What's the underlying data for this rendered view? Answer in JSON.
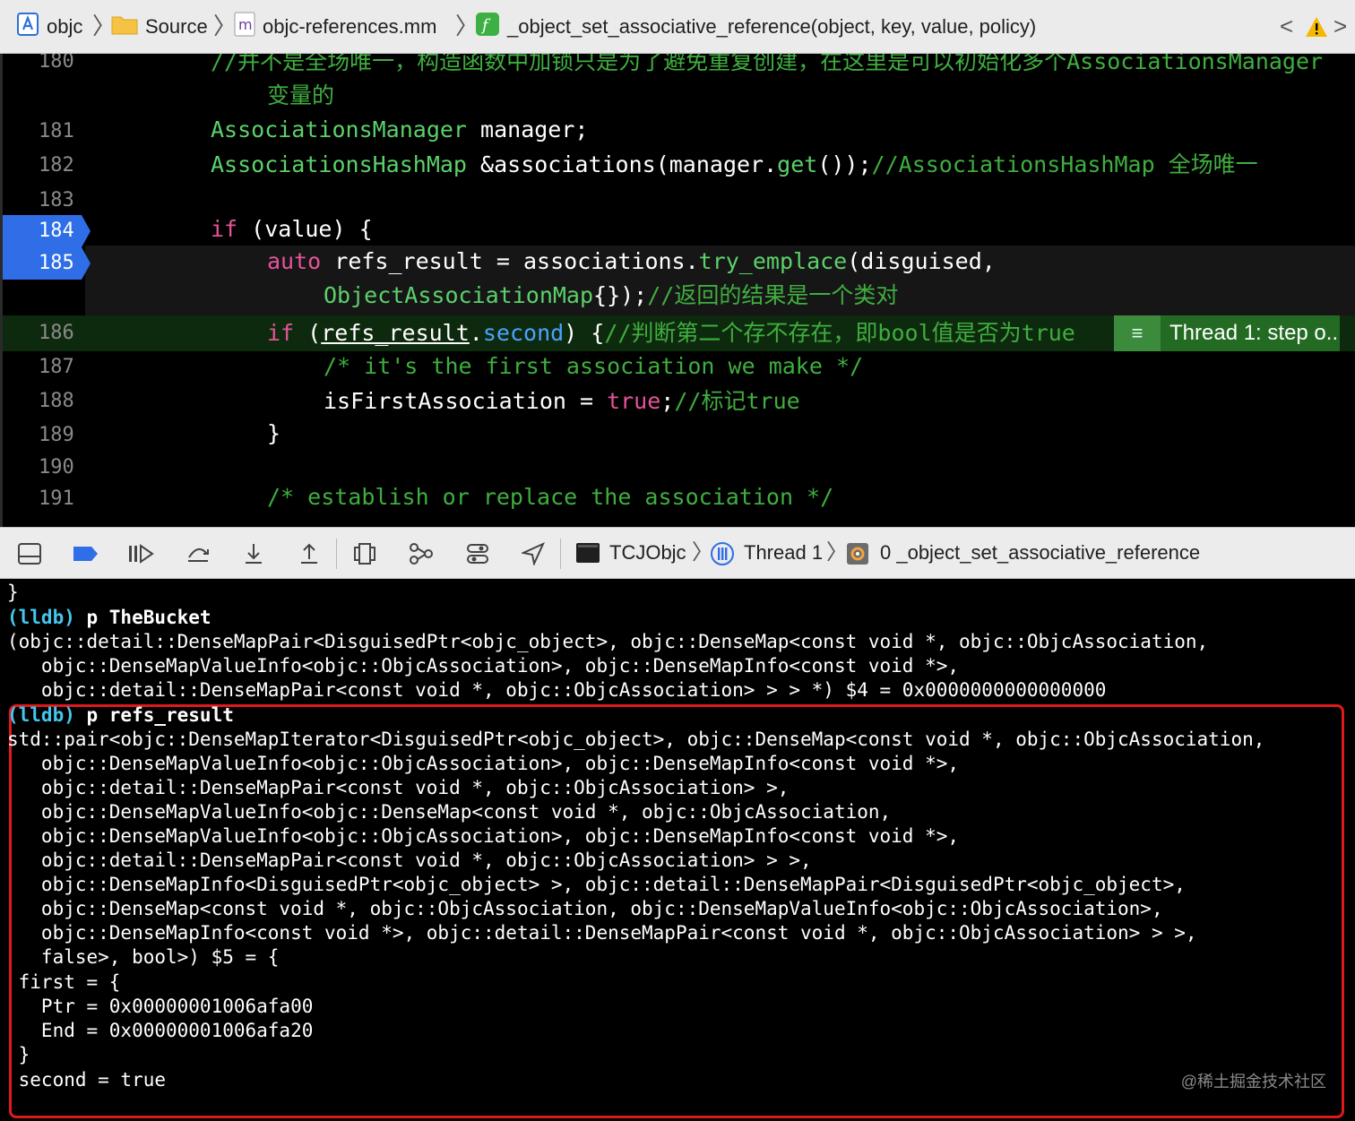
{
  "breadcrumb": {
    "project": "objc",
    "folder": "Source",
    "file": "objc-references.mm",
    "function": "_object_set_associative_reference(object, key, value, policy)"
  },
  "editor": {
    "lines": {
      "l180": "180",
      "l181": "181",
      "l182": "182",
      "l183": "183",
      "l184": "184",
      "l185": "185",
      "l186": "186",
      "l187": "187",
      "l188": "188",
      "l189": "189",
      "l190": "190",
      "l191": "191"
    },
    "code": {
      "c180a": "//并不是全场唯一，构造函数中加锁只是为了避免重复创建，在这里是可以初始化多个AssociationsManager",
      "c180b": "变量的",
      "c181_type": "AssociationsManager",
      "c181_rest": " manager;",
      "c182_type": "AssociationsHashMap",
      "c182_mid": " &associations(manager.",
      "c182_fn": "get",
      "c182_end": "());",
      "c182_cm": "//AssociationsHashMap 全场唯一",
      "c184_kw": "if",
      "c184_rest": " (value) {",
      "c185_kw": "auto",
      "c185_mid": " refs_result = associations.",
      "c185_fn": "try_emplace",
      "c185_end": "(disguised,",
      "c185b_type": "ObjectAssociationMap",
      "c185b_rest": "{});",
      "c185b_cm": "//返回的结果是一个类对",
      "c186_kw": "if",
      "c186_a": " (",
      "c186_var": "refs_result",
      "c186_dot": ".",
      "c186_prop": "second",
      "c186_b": ") {",
      "c186_cm": "//判断第二个存不存在，即bool值是否为true",
      "c187_cm": "/* it's the first association we make */",
      "c188_a": "isFirstAssociation = ",
      "c188_kw": "true",
      "c188_b": ";",
      "c188_cm": "//标记true",
      "c189": "}",
      "c191_cm": "/* establish or replace the association */"
    },
    "thread_badge": "Thread 1: step o..."
  },
  "debug_bar": {
    "target": "TCJObjc",
    "thread": "Thread 1",
    "frame": "0 _object_set_associative_reference"
  },
  "console": {
    "brace_top": "}",
    "prompt": "(lldb)",
    "cmd1": " p TheBucket",
    "out1_1": "(objc::detail::DenseMapPair<DisguisedPtr<objc_object>, objc::DenseMap<const void *, objc::ObjcAssociation,",
    "out1_2": "   objc::DenseMapValueInfo<objc::ObjcAssociation>, objc::DenseMapInfo<const void *>,",
    "out1_3": "   objc::detail::DenseMapPair<const void *, objc::ObjcAssociation> > > *) $4 = 0x0000000000000000",
    "cmd2": " p refs_result",
    "out2_1": "std::pair<objc::DenseMapIterator<DisguisedPtr<objc_object>, objc::DenseMap<const void *, objc::ObjcAssociation,",
    "out2_2": "   objc::DenseMapValueInfo<objc::ObjcAssociation>, objc::DenseMapInfo<const void *>,",
    "out2_3": "   objc::detail::DenseMapPair<const void *, objc::ObjcAssociation> >,",
    "out2_4": "   objc::DenseMapValueInfo<objc::DenseMap<const void *, objc::ObjcAssociation,",
    "out2_5": "   objc::DenseMapValueInfo<objc::ObjcAssociation>, objc::DenseMapInfo<const void *>,",
    "out2_6": "   objc::detail::DenseMapPair<const void *, objc::ObjcAssociation> > >,",
    "out2_7": "   objc::DenseMapInfo<DisguisedPtr<objc_object> >, objc::detail::DenseMapPair<DisguisedPtr<objc_object>,",
    "out2_8": "   objc::DenseMap<const void *, objc::ObjcAssociation, objc::DenseMapValueInfo<objc::ObjcAssociation>,",
    "out2_9": "   objc::DenseMapInfo<const void *>, objc::detail::DenseMapPair<const void *, objc::ObjcAssociation> > >,",
    "out2_10": "   false>, bool>) $5 = {",
    "out2_11": " first = {",
    "out2_12": "   Ptr = 0x00000001006afa00",
    "out2_13": "   End = 0x00000001006afa20",
    "out2_14": " }",
    "out2_15": " second = true"
  },
  "watermark": "@稀土掘金技术社区",
  "colors": {
    "accent": "#2f6ee6",
    "highlight": "#e0191d",
    "comment": "#3fae3f",
    "keyword": "#e6539a"
  }
}
